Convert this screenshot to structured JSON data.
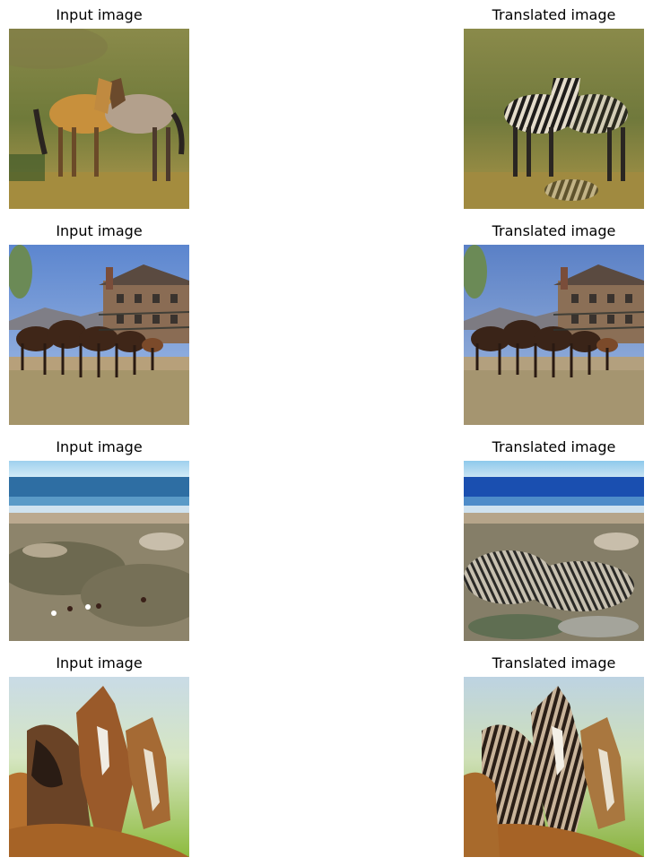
{
  "rows": [
    {
      "input_title": "Input image",
      "output_title": "Translated image",
      "input_subject": "two horses on grassy hillside",
      "output_subject": "two zebra-striped horses on grassy hillside"
    },
    {
      "input_title": "Input image",
      "output_title": "Translated image",
      "input_subject": "herd of horses near brick building",
      "output_subject": "herd of horses near brick building"
    },
    {
      "input_title": "Input image",
      "output_title": "Translated image",
      "input_subject": "beach with dunes and small horses",
      "output_subject": "beach with dunes and zebra-like pattern"
    },
    {
      "input_title": "Input image",
      "output_title": "Translated image",
      "input_subject": "three brown horses close-up",
      "output_subject": "three zebra-striped horses close-up"
    }
  ]
}
